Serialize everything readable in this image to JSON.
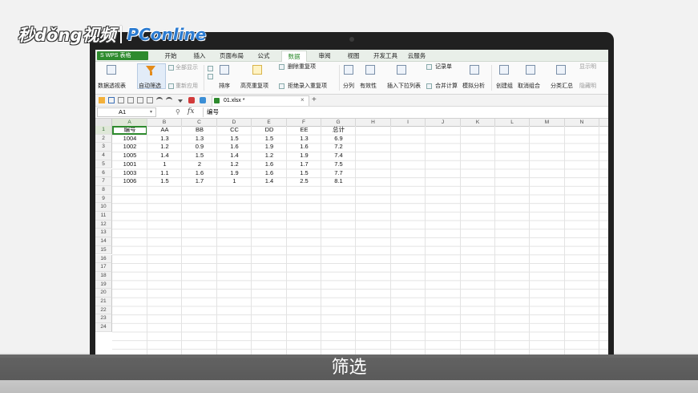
{
  "watermark": {
    "left": "秒dǒng视频",
    "right": "PConline"
  },
  "subtitle": "筛选",
  "menu": {
    "logo": "S WPS 表格",
    "tabs": [
      "开始",
      "插入",
      "页面布局",
      "公式",
      "数据",
      "审阅",
      "视图",
      "开发工具",
      "云服务"
    ],
    "active": "数据"
  },
  "ribbon": {
    "pivot": "数据透视表",
    "autofilter": "自动筛选",
    "show_all": "全部显示",
    "reapply": "重新应用",
    "sort": "排序",
    "highlight_dup": "高亮重复项",
    "delete_dup": "删除重复项",
    "reject_dup": "拒绝录入重复项",
    "split": "分列",
    "validity": "有效性",
    "dropdown": "插入下拉列表",
    "record": "记录单",
    "consolidate": "合并计算",
    "simulate": "模拟分析",
    "group": "创建组",
    "ungroup": "取消组合",
    "subtotal": "分类汇总",
    "show_detail": "显示明",
    "hide_detail": "隐藏明"
  },
  "toolbar": {
    "file_tab": "01.xlsx *",
    "close": "×",
    "new_tab": "+"
  },
  "formula": {
    "cell_ref": "A1",
    "fx": "fx",
    "value": "编号"
  },
  "columns": [
    "A",
    "B",
    "C",
    "D",
    "E",
    "F",
    "G",
    "H",
    "I",
    "J",
    "K",
    "L",
    "M",
    "N"
  ],
  "rows": [
    "1",
    "2",
    "3",
    "4",
    "5",
    "6",
    "7",
    "8",
    "9",
    "10",
    "11",
    "12",
    "13",
    "14",
    "15",
    "16",
    "17",
    "18",
    "19",
    "20",
    "21",
    "22",
    "23",
    "24"
  ],
  "table": {
    "header": [
      "编号",
      "AA",
      "BB",
      "CC",
      "DD",
      "EE",
      "总计"
    ],
    "data": [
      [
        "1004",
        "1.3",
        "1.3",
        "1.5",
        "1.5",
        "1.3",
        "6.9"
      ],
      [
        "1002",
        "1.2",
        "0.9",
        "1.6",
        "1.9",
        "1.6",
        "7.2"
      ],
      [
        "1005",
        "1.4",
        "1.5",
        "1.4",
        "1.2",
        "1.9",
        "7.4"
      ],
      [
        "1001",
        "1",
        "2",
        "1.2",
        "1.6",
        "1.7",
        "7.5"
      ],
      [
        "1003",
        "1.1",
        "1.6",
        "1.9",
        "1.6",
        "1.5",
        "7.7"
      ],
      [
        "1006",
        "1.5",
        "1.7",
        "1",
        "1.4",
        "2.5",
        "8.1"
      ]
    ]
  }
}
